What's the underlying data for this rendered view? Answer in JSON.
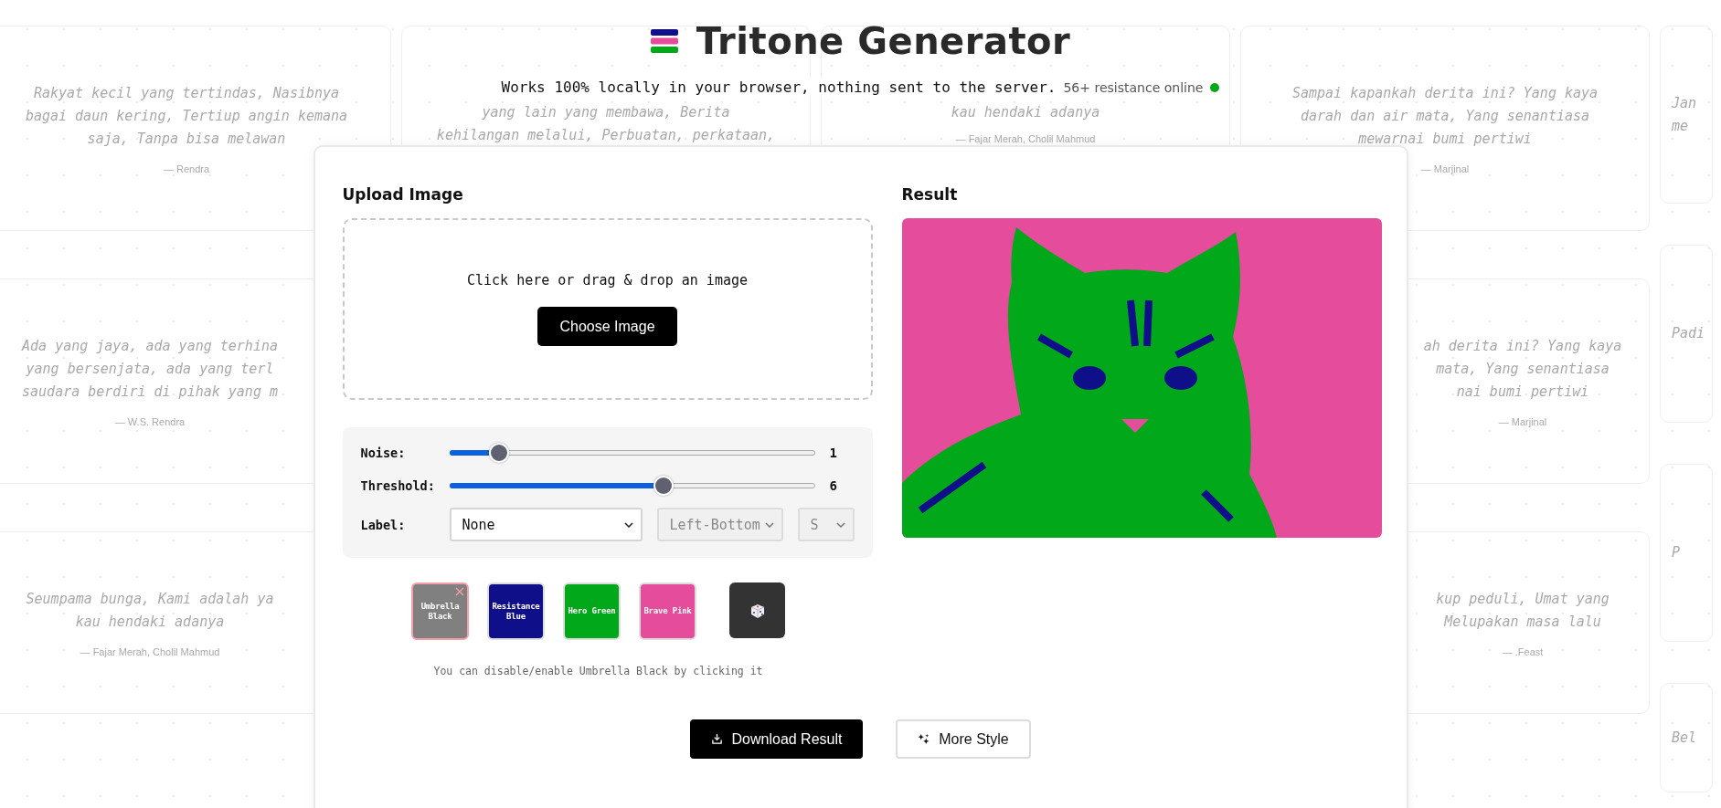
{
  "background_columns": [
    {
      "cards": [
        {
          "quote": "Rakyat kecil yang tertindas, Nasibnya\nbagai daun kering, Tertiup angin kemana\nsaja, Tanpa bisa melawan",
          "author": "— Rendra"
        },
        {
          "quote": "Ada yang jaya, ada yang terhina\nyang bersenjata, ada yang terl\nsaudara berdiri di pihak yang m",
          "author": "— W.S. Rendra"
        },
        {
          "quote": "Seumpama bunga, Kami adalah ya\nkau hendaki adanya",
          "author": "— Fajar Merah, Cholil Mahmud"
        }
      ]
    },
    {
      "cards": [
        {
          "quote": "yang lain yang membawa, Berita\nkehilangan melalui, Perbuatan, perkataan,"
        }
      ]
    },
    {
      "cards": [
        {
          "quote": "kau hendaki adanya",
          "author": "— Fajar Merah, Cholil Mahmud"
        }
      ]
    },
    {
      "cards": [
        {
          "quote": "Sampai kapankah derita ini? Yang kaya\ndarah dan air mata, Yang senantiasa\nmewarnai bumi pertiwi",
          "author": "— Marjinal"
        },
        {
          "quote": "ah derita ini? Yang kaya\nmata, Yang senantiasa\nnai bumi pertiwi",
          "author": "— Marjinal"
        },
        {
          "quote": "kup peduli, Umat yang\nMelupakan masa lalu",
          "author": "— .Feast"
        }
      ]
    },
    {
      "cards": [
        {
          "quote": "Jan\nme"
        },
        {
          "quote": "Padi"
        },
        {
          "quote": "P"
        },
        {
          "quote": "Bel"
        }
      ]
    }
  ],
  "header": {
    "title": "Tritone Generator",
    "subtitle": "Works 100% locally in your browser, nothing sent to the server.",
    "online": "56+ resistance online",
    "online_on": true
  },
  "upload": {
    "heading": "Upload Image",
    "prompt": "Click here or drag & drop an image",
    "button": "Choose Image"
  },
  "controls": [
    {
      "kind": "slider",
      "label": "Noise:",
      "level": 0.12,
      "reading": "1"
    },
    {
      "kind": "slider",
      "label": "Threshold:",
      "level": 0.59,
      "reading": "6"
    },
    {
      "kind": "select",
      "label": "Label:",
      "selects": [
        {
          "value": "None",
          "disabled": false
        },
        {
          "value": "Left-Bottom",
          "disabled": true
        },
        {
          "value": "S",
          "disabled": true
        }
      ]
    }
  ],
  "swatches": [
    {
      "label": "Umbrella Black",
      "color": "#808080",
      "disabled": true
    },
    {
      "label": "Resistance Blue",
      "color": "#0f0f8a",
      "disabled": false
    },
    {
      "label": "Hero Green",
      "color": "#00a81a",
      "disabled": false
    },
    {
      "label": "Brave Pink",
      "color": "#e54c9b",
      "disabled": false
    }
  ],
  "hint": "You can disable/enable Umbrella Black by clicking it",
  "result": {
    "heading": "Result"
  },
  "actions": [
    {
      "kind": "primary",
      "label": "Download Result"
    },
    {
      "kind": "secondary",
      "label": "More Style"
    }
  ]
}
